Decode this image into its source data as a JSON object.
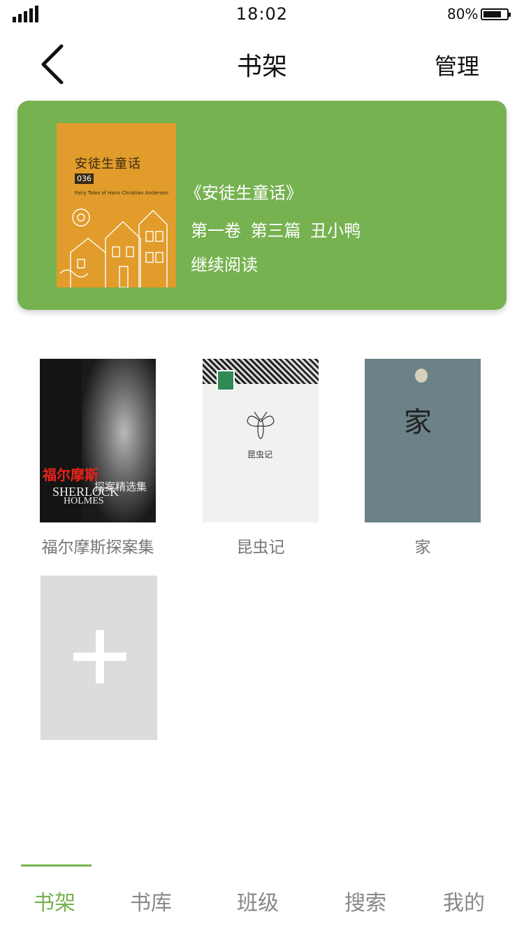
{
  "status_bar": {
    "time": "18:02",
    "battery": "80%"
  },
  "header": {
    "back_icon": "chevron-left-icon",
    "title": "书架",
    "manage_label": "管理"
  },
  "recent": {
    "title": "《安徒生童话》",
    "chapter": "第一卷  第三篇  丑小鸭",
    "continue_label": "继续阅读",
    "cover": {
      "title": "安徒生童话",
      "number": "036",
      "subtitle": "Fairy Tales of Hans Christian Andersen"
    },
    "background_color": "#76b250"
  },
  "books": [
    {
      "label": "福尔摩斯探案集",
      "cover_zh": "福尔摩斯",
      "cover_zh2": "探案精选集",
      "cover_en1": "SHERLOCK",
      "cover_en2": "HOLMES"
    },
    {
      "label": "昆虫记",
      "cover_title": "昆虫记"
    },
    {
      "label": "家",
      "cover_title": "家"
    }
  ],
  "add_book": {
    "icon": "plus-icon"
  },
  "tabs": [
    {
      "label": "书架",
      "active": true
    },
    {
      "label": "书库"
    },
    {
      "label": "班级"
    },
    {
      "label": "搜索"
    },
    {
      "label": "我的"
    }
  ],
  "colors": {
    "accent": "#76b250",
    "inactive_tab": "#888888"
  }
}
